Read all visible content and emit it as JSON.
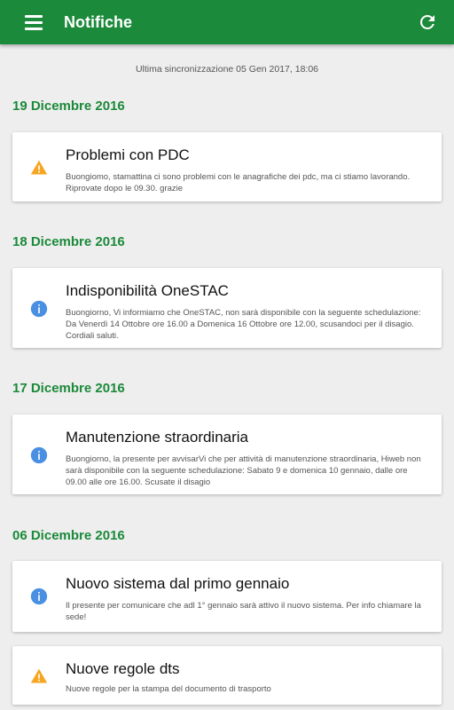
{
  "appbar": {
    "title": "Notifiche",
    "menu_icon": "hamburger-menu-icon",
    "refresh_icon": "refresh-icon",
    "color": "#1b8a3a"
  },
  "sync_text": "Ultima sincronizzazione 05 Gen 2017, 18:06",
  "groups": [
    {
      "date": "19 Dicembre 2016",
      "notifications": [
        {
          "type": "warning",
          "icon": "warning-icon",
          "title": "Problemi con PDC",
          "body": "Buongiomo, stamattina ci sono problemi con le anagrafiche dei pdc, ma ci stiamo lavorando. Riprovate dopo le 09.30. grazie"
        }
      ]
    },
    {
      "date": "18 Dicembre 2016",
      "notifications": [
        {
          "type": "info",
          "icon": "info-icon",
          "title": "Indisponibilità OneSTAC",
          "body": "Buongiorno, Vi informiamo che OneSTAC, non sarà disponibile con la seguente schedulazione: Da Venerdì 14 Ottobre ore 16.00 a Domenica 16 Ottobre ore 12.00, scusandoci per il disagio. Cordiali saluti."
        }
      ]
    },
    {
      "date": "17 Dicembre 2016",
      "notifications": [
        {
          "type": "info",
          "icon": "info-icon",
          "title": "Manutenzione straordinaria",
          "body": "Buongiorno, la presente per avvisarVi che per attività di manutenzione straordinaria, Hiweb non sarà disponibile con la seguente schedulazione: Sabato 9 e domenica 10 gennaio, dalle ore 09.00 alle ore 16.00. Scusate il disagio"
        }
      ]
    },
    {
      "date": "06 Dicembre 2016",
      "notifications": [
        {
          "type": "info",
          "icon": "info-icon",
          "title": "Nuovo sistema dal primo gennaio",
          "body": "Il presente per comunicare che adl 1° gennaio sarà attivo il nuovo sistema. Per info chiamare la sede!"
        },
        {
          "type": "warning",
          "icon": "warning-icon",
          "title": "Nuove regole dts",
          "body": "Nuove regole per la stampa del documento di trasporto"
        }
      ]
    }
  ],
  "colors": {
    "accent": "#1b8a3a",
    "warning": "#f5a623",
    "info": "#4a90e2"
  }
}
